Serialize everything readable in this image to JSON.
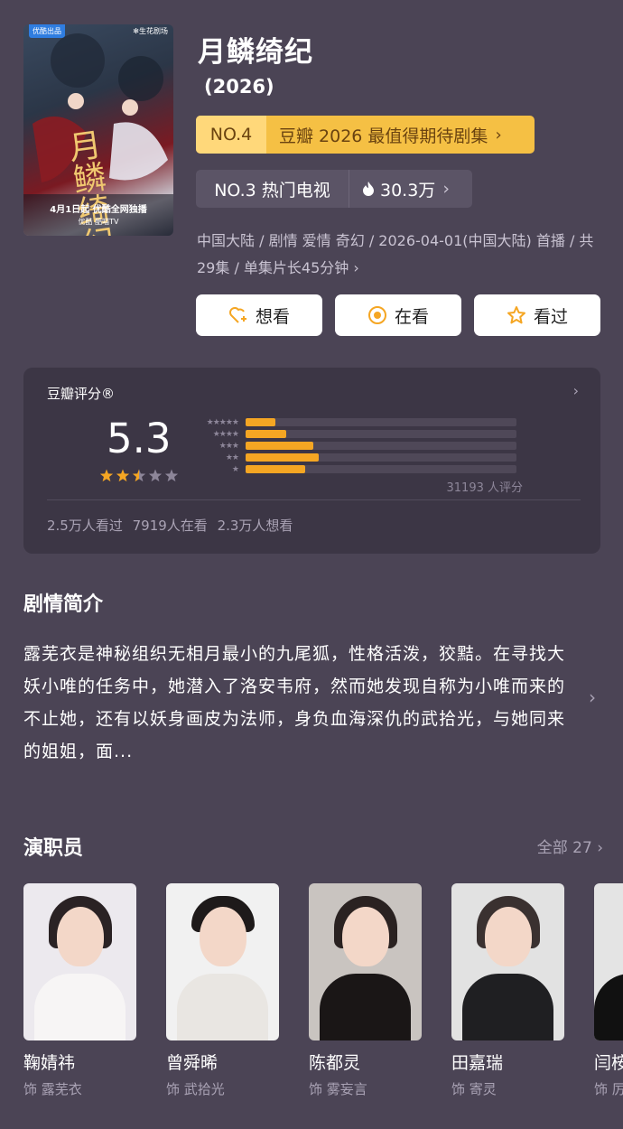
{
  "poster": {
    "tag_left": "优酷出品",
    "tag_right": "✻生花剧场",
    "calligraphy": "月鳞绮纪",
    "release_line": "4月1日起 优酷全网独播",
    "platforms": "优酷  酷喵TV"
  },
  "show": {
    "title": "月鳞绮纪",
    "year": "(2026)",
    "rank_primary": {
      "no": "NO.4",
      "label": "豆瓣 2026 最值得期待剧集"
    },
    "rank_secondary": {
      "no": "NO.3 热门电视",
      "heat": "30.3万"
    },
    "meta": "中国大陆 / 剧情 爱情 奇幻 / 2026-04-01(中国大陆) 首播 / 共29集 / 单集片长45分钟 ›"
  },
  "actions": [
    {
      "label": "想看",
      "icon": "heart-plus-icon"
    },
    {
      "label": "在看",
      "icon": "target-icon"
    },
    {
      "label": "看过",
      "icon": "star-outline-icon"
    }
  ],
  "rating": {
    "heading": "豆瓣评分®",
    "score": "5.3",
    "stars_value": 2.5,
    "distribution": [
      {
        "stars": "★★★★★",
        "fraction": 0.11
      },
      {
        "stars": "★★★★",
        "fraction": 0.15
      },
      {
        "stars": "★★★",
        "fraction": 0.25
      },
      {
        "stars": "★★",
        "fraction": 0.27
      },
      {
        "stars": "★",
        "fraction": 0.22
      }
    ],
    "count": "31193 人评分",
    "stats": "2.5万人看过  7919人在看  2.3万人想看",
    "star_color": "#f5a623"
  },
  "synopsis": {
    "title": "剧情简介",
    "text": "露芜衣是神秘组织无相月最小的九尾狐，性格活泼，狡黠。在寻找大妖小唯的任务中，她潜入了洛安韦府，然而她发现自称为小唯而来的不止她，还有以妖身画皮为法师，身负血海深仇的武拾光，与她同来的姐姐，面..."
  },
  "cast": {
    "title": "演职员",
    "all_label": "全部 27 ›",
    "members": [
      {
        "name": "鞠婧祎",
        "role": "饰 露芜衣"
      },
      {
        "name": "曾舜晞",
        "role": "饰 武拾光"
      },
      {
        "name": "陈都灵",
        "role": "饰 雾妄言"
      },
      {
        "name": "田嘉瑞",
        "role": "饰 寄灵"
      },
      {
        "name": "闫桉",
        "role": "饰 厉"
      }
    ]
  }
}
